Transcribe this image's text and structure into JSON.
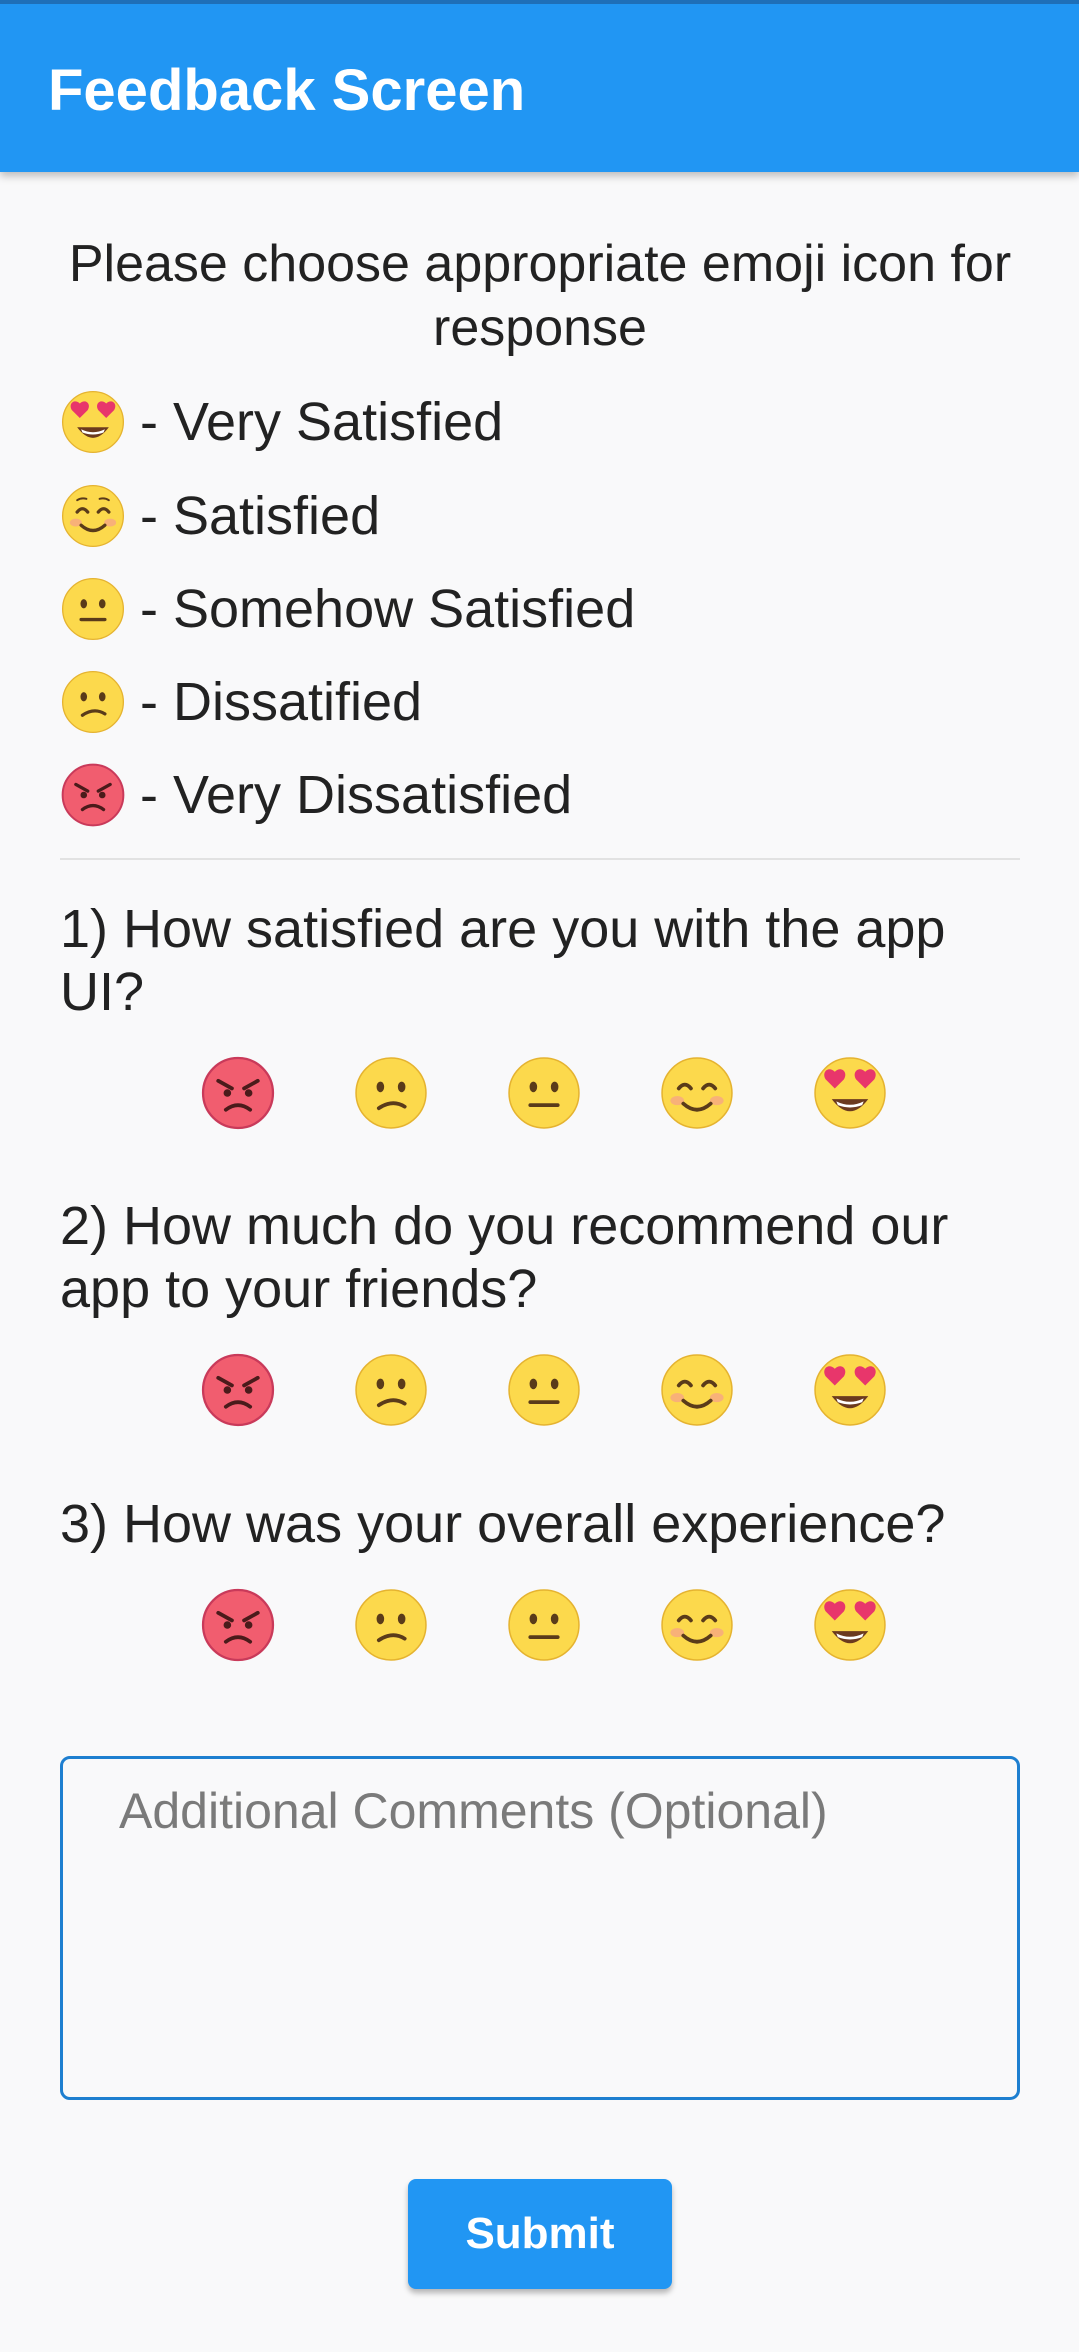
{
  "app_bar": {
    "title": "Feedback Screen"
  },
  "instruction": "Please choose appropriate emoji icon for response",
  "legend": [
    {
      "icon": "heart-eyes-emoji-icon",
      "label": "- Very Satisfied"
    },
    {
      "icon": "smiling-emoji-icon",
      "label": "- Satisfied"
    },
    {
      "icon": "neutral-emoji-icon",
      "label": "- Somehow Satisfied"
    },
    {
      "icon": "confused-emoji-icon",
      "label": "- Dissatified"
    },
    {
      "icon": "angry-emoji-icon",
      "label": "- Very Dissatisfied"
    }
  ],
  "questions": [
    {
      "text": "1) How satisfied are you with the app UI?"
    },
    {
      "text": "2) How much do you recommend our app to your friends?"
    },
    {
      "text": "3) How was your overall experience?"
    }
  ],
  "rating_order": [
    "angry-emoji-icon",
    "confused-emoji-icon",
    "neutral-emoji-icon",
    "smiling-emoji-icon",
    "heart-eyes-emoji-icon"
  ],
  "comments": {
    "placeholder": "Additional Comments (Optional)",
    "value": ""
  },
  "submit_label": "Submit",
  "colors": {
    "primary": "#2196f3",
    "field_border": "#1e7fd0",
    "emoji_yellow": "#fcd94c",
    "emoji_red": "#f15d6f",
    "heart": "#e8366b"
  }
}
